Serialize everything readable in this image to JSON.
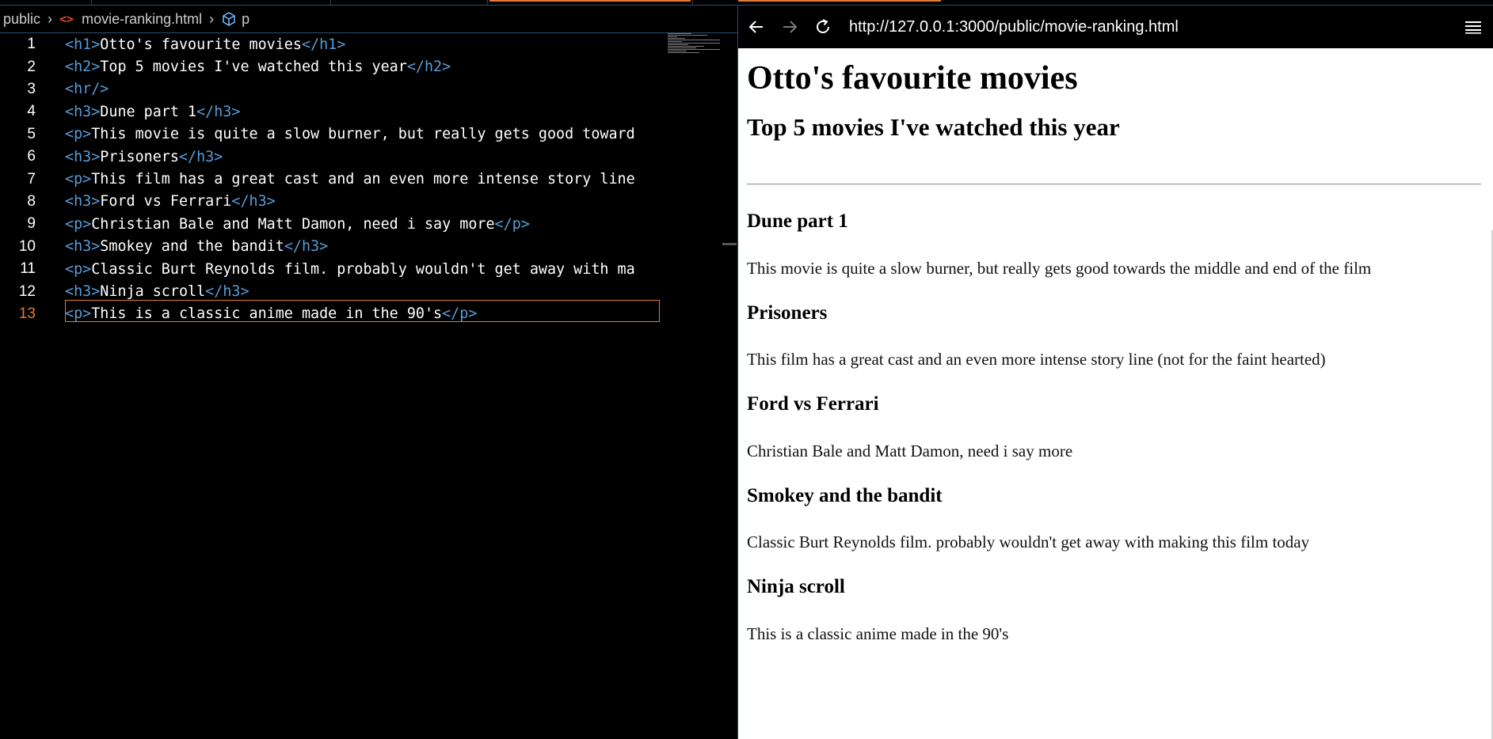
{
  "editor": {
    "breadcrumb": {
      "folder": "public",
      "file": "movie-ranking.html",
      "symbol": "p"
    },
    "current_line": "13",
    "lines": [
      {
        "num": "1",
        "open": "<h1>",
        "text": "Otto's favourite movies",
        "close": "</h1>"
      },
      {
        "num": "2",
        "open": "<h2>",
        "text": "Top 5 movies I've watched this year",
        "close": "</h2>"
      },
      {
        "num": "3",
        "open": "<hr/>",
        "text": "",
        "close": ""
      },
      {
        "num": "4",
        "open": "<h3>",
        "text": "Dune part 1",
        "close": "</h3>"
      },
      {
        "num": "5",
        "open": "<p>",
        "text": "This movie is quite a slow burner, but really gets good toward",
        "close": ""
      },
      {
        "num": "6",
        "open": "<h3>",
        "text": "Prisoners",
        "close": "</h3>"
      },
      {
        "num": "7",
        "open": "<p>",
        "text": "This film has a great cast and an even more intense story line",
        "close": ""
      },
      {
        "num": "8",
        "open": "<h3>",
        "text": "Ford vs Ferrari",
        "close": "</h3>"
      },
      {
        "num": "9",
        "open": "<p>",
        "text": "Christian Bale and Matt Damon, need i say more",
        "close": "</p>"
      },
      {
        "num": "10",
        "open": "<h3>",
        "text": "Smokey and the bandit",
        "close": "</h3>"
      },
      {
        "num": "11",
        "open": "<p>",
        "text": "Classic Burt Reynolds film. probably wouldn't get away with ma",
        "close": ""
      },
      {
        "num": "12",
        "open": "<h3>",
        "text": "Ninja scroll",
        "close": "</h3>"
      },
      {
        "num": "13",
        "open": "<p>",
        "text": "This is a classic anime made in the 90's",
        "close": "</p>"
      }
    ]
  },
  "browser": {
    "url": "http://127.0.0.1:3000/public/movie-ranking.html",
    "back_icon": "arrow-left",
    "forward_icon": "arrow-right",
    "reload_icon": "reload",
    "menu_icon": "hamburger-menu",
    "page": {
      "h1": "Otto's favourite movies",
      "h2": "Top 5 movies I've watched this year",
      "movies": [
        {
          "title": "Dune part 1",
          "description": "This movie is quite a slow burner, but really gets good towards the middle and end of the film"
        },
        {
          "title": "Prisoners",
          "description": "This film has a great cast and an even more intense story line (not for the faint hearted)"
        },
        {
          "title": "Ford vs Ferrari",
          "description": "Christian Bale and Matt Damon, need i say more"
        },
        {
          "title": "Smokey and the bandit",
          "description": "Classic Burt Reynolds film. probably wouldn't get away with making this film today"
        },
        {
          "title": "Ninja scroll",
          "description": "This is a classic anime made in the 90's"
        }
      ]
    }
  },
  "colors": {
    "editor_bg": "#000000",
    "tag": "#569cd6",
    "text": "#ffffff",
    "accent": "#e37933",
    "border": "#2a4f6e"
  }
}
